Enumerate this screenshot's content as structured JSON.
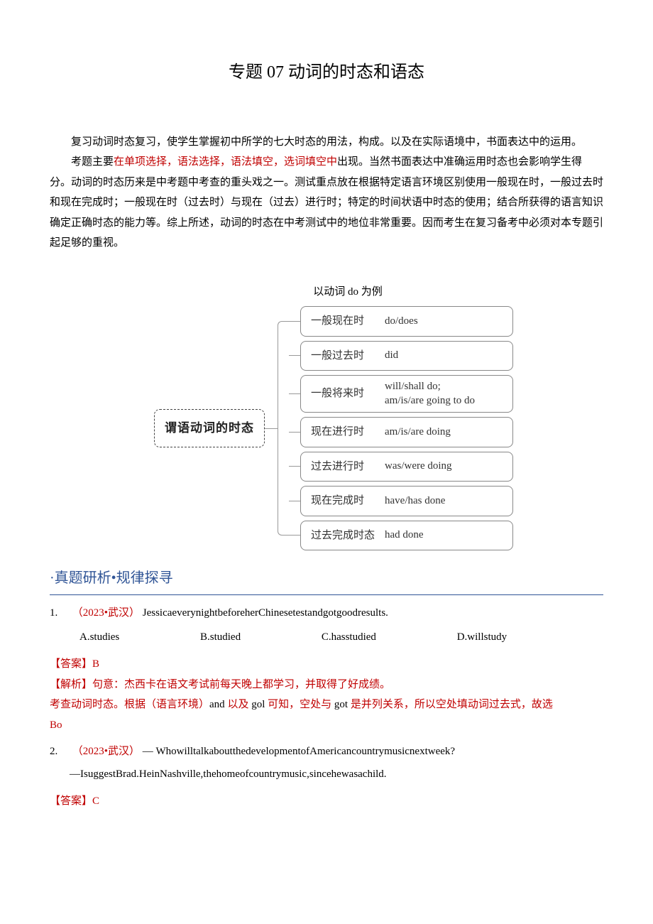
{
  "title": "专题 07 动词的时态和语态",
  "intro": {
    "p1": "复习动词时态复习，使学生掌握初中所学的七大时态的用法，构成。以及在实际语境中，书面表达中的运用。",
    "p2_pre": "考题主要",
    "p2_hl": "在单项选择，语法选择，语法填空，选词填空中",
    "p2_post": "出现。当然书面表达中准确运用时态也会影响学生得分。动词的时态历来是中考题中考查的重头戏之一。测试重点放在根据特定语言环境区别使用一般现在时，一般过去时和现在完成时；一般现在时（过去时）与现在（过去）进行时；特定的时间状语中时态的使用；结合所获得的语言知识确定正确时态的能力等。综上所述，动词的时态在中考测试中的地位非常重要。因而考生在复习备考中必须对本专题引起足够的重视。"
  },
  "diagram": {
    "caption": "以动词 do 为例",
    "root": "谓语动词的时态",
    "leaves": [
      {
        "k": "一般现在时",
        "v": "do/does"
      },
      {
        "k": "一般过去时",
        "v": "did"
      },
      {
        "k": "一般将来时",
        "v": "will/shall do;\nam/is/are going to do"
      },
      {
        "k": "现在进行时",
        "v": "am/is/are doing"
      },
      {
        "k": "过去进行时",
        "v": "was/were doing"
      },
      {
        "k": "现在完成时",
        "v": "have/has done"
      },
      {
        "k": "过去完成时态",
        "v": "had done"
      }
    ]
  },
  "section_title": "·真题研析•规律探寻",
  "questions": [
    {
      "num": "1.",
      "source": "（2023•武汉）",
      "stem": "JessicaeverynightbeforeherChinesetestandgotgoodresults.",
      "options": {
        "A": "A.studies",
        "B": "B.studied",
        "C": "C.hasstudied",
        "D": "D.willstudy"
      },
      "answer_label": "【答案】",
      "answer": "B",
      "analysis": {
        "label": "【解析】",
        "sentence": "句意：杰西卡在语文考试前每天晚上都学习，并取得了好成绩。",
        "line2_pre": "考查动词时态。根据（语言环境）",
        "line2_black1": "and",
        "line2_mid1": " 以及 ",
        "line2_black2": "gol",
        "line2_mid2": " 可知，空处与 ",
        "line2_black3": "got",
        "line2_post": " 是并列关系，所以空处填动词过去式，故选",
        "line3": "Bo"
      }
    },
    {
      "num": "2.",
      "source": "（2023•武汉）",
      "stem_pre": "— ",
      "stem": "WhowilltalkaboutthedevelopmentofAmericancountrymusicnextweek?",
      "stem2": "—IsuggestBrad.HeinNashville,thehomeofcountrymusic,sincehewasachild.",
      "answer_label": "【答案】",
      "answer": "C"
    }
  ]
}
